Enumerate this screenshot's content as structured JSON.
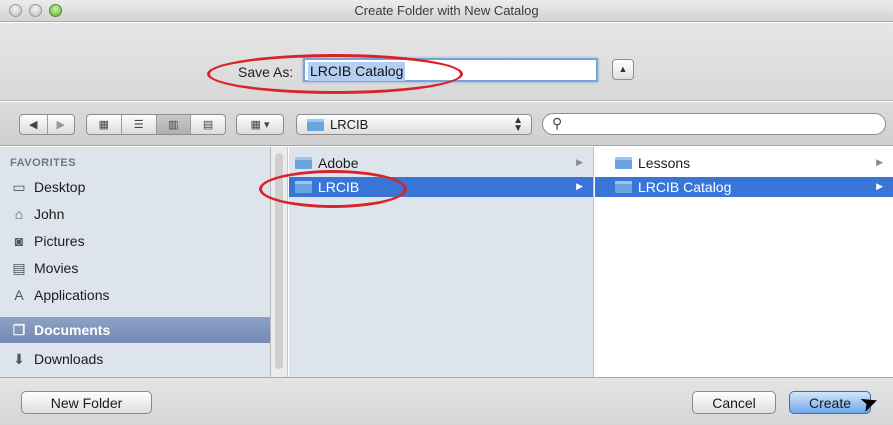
{
  "window": {
    "title": "Create Folder with New Catalog"
  },
  "save": {
    "label": "Save As:",
    "value": "LRCIB Catalog",
    "disclose_symbol": "▲"
  },
  "toolbar": {
    "back": "◀",
    "forward": "▶",
    "view_icons": "▦",
    "view_list": "☰",
    "view_columns": "▥",
    "view_coverflow": "▤",
    "arrange": "▦ ▾",
    "location": "LRCIB",
    "search_placeholder": ""
  },
  "sidebar": {
    "heading": "FAVORITES",
    "items": [
      {
        "label": "Desktop",
        "icon": "desktop-icon",
        "glyph": "▭"
      },
      {
        "label": "John",
        "icon": "home-icon",
        "glyph": "⌂"
      },
      {
        "label": "Pictures",
        "icon": "camera-icon",
        "glyph": "◙"
      },
      {
        "label": "Movies",
        "icon": "film-icon",
        "glyph": "▤"
      },
      {
        "label": "Applications",
        "icon": "applications-icon",
        "glyph": "A"
      },
      {
        "label": "Documents",
        "icon": "documents-icon",
        "glyph": "❐"
      },
      {
        "label": "Downloads",
        "icon": "downloads-icon",
        "glyph": "⬇"
      }
    ],
    "selected": "Documents"
  },
  "columns": [
    {
      "items": [
        {
          "label": "Adobe"
        },
        {
          "label": "LRCIB"
        }
      ],
      "selected": "LRCIB"
    },
    {
      "items": [
        {
          "label": "Lessons"
        },
        {
          "label": "LRCIB Catalog"
        }
      ],
      "selected": "LRCIB Catalog"
    }
  ],
  "buttons": {
    "new_folder": "New Folder",
    "cancel": "Cancel",
    "create": "Create"
  },
  "colors": {
    "annotation_red": "#d8232a",
    "selection_blue": "#3875d7",
    "sidebar_bg": "#dde4ec"
  }
}
